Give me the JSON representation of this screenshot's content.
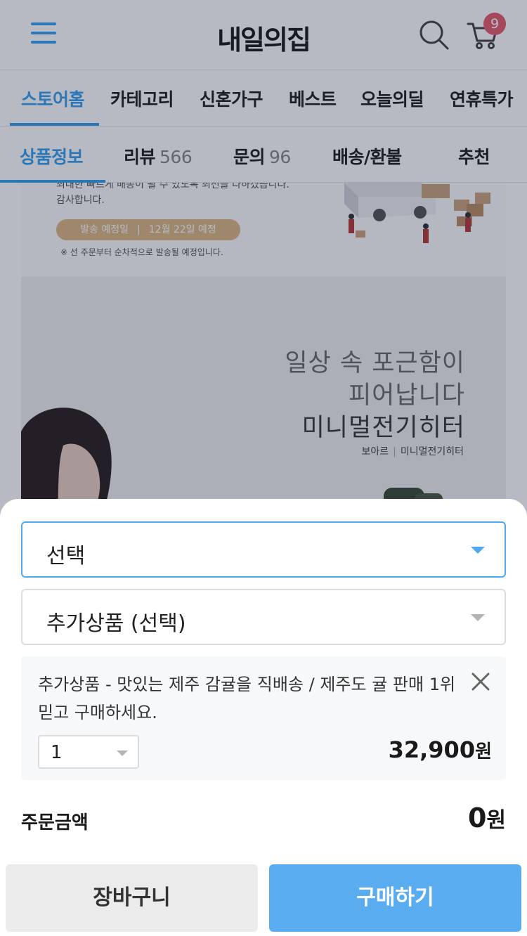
{
  "header": {
    "logo": "내일의집",
    "cart_count": "9"
  },
  "category_nav": {
    "items": [
      {
        "label": "스토어홈",
        "active": true
      },
      {
        "label": "카테고리"
      },
      {
        "label": "신혼가구"
      },
      {
        "label": "베스트"
      },
      {
        "label": "오늘의딜"
      },
      {
        "label": "연휴특가"
      }
    ]
  },
  "product_tabs": {
    "info": "상품정보",
    "review": "리뷰",
    "review_count": "566",
    "qna": "문의",
    "qna_count": "96",
    "shipping": "배송/환불",
    "recommend": "추천"
  },
  "content": {
    "notice_line1": "최대한 빠르게 배송이 될 수 있도록 최선을 다하겠습니다.",
    "notice_line2": "감사합니다.",
    "ship_label": "발송 예정일",
    "ship_date": "12월 22일 예정",
    "notice_small": "※ 선 주문부터 순차적으로 발송될 예정입니다.",
    "banner_line1": "일상 속 포근함이",
    "banner_line2": "피어납니다",
    "banner_line3": "미니멀전기히터",
    "banner_brand": "보아르",
    "banner_product": "미니멀전기히터"
  },
  "sheet": {
    "option_select": "선택",
    "addon_select": "추가상품 (선택)",
    "addon_title": "추가상품 - 맛있는 제주 감귤을 직배송 / 제주도 귤 판매 1위 믿고 구매하세요.",
    "addon_qty": "1",
    "addon_price": "32,900",
    "currency": "원",
    "total_label": "주문금액",
    "total_value": "0",
    "cart_button": "장바구니",
    "buy_button": "구매하기"
  },
  "colors": {
    "accent": "#35a0f0",
    "buy_button": "#5aacf1",
    "badge": "#e65c6a",
    "ship_pill": "#dab681"
  }
}
